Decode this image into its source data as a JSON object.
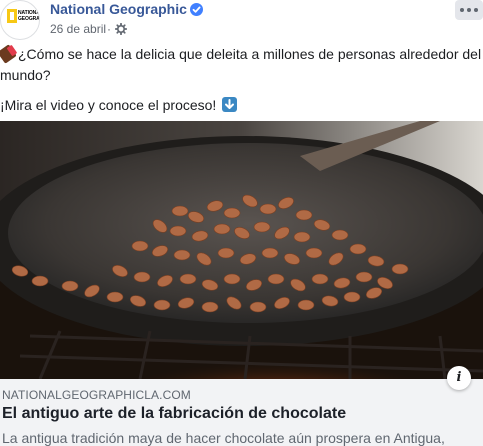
{
  "post": {
    "page_name": "National Geographic",
    "avatar_text": "NATIONAL GEOGRAPHIC",
    "date": "26 de abril",
    "separator": "·",
    "text_line1": "¿Cómo se hace la delicia que deleita a millones de personas alrededor del mundo?",
    "text_line2": "¡Mira el video y conoce el proceso!",
    "icons": [
      "chocolate-emoji",
      "down-arrow-emoji",
      "verified-badge",
      "globe-icon",
      "more-options-icon",
      "info-icon"
    ]
  },
  "link": {
    "domain": "NATIONALGEOGRAPHICLA.COM",
    "title": "El antiguo arte de la fabricación de chocolate",
    "description": "La antigua tradición maya de hacer chocolate aún prospera en Antigua,",
    "info_label": "i"
  },
  "colors": {
    "page_name": "#385898",
    "verified": "#4080ff",
    "link_meta_bg": "#f2f3f5"
  }
}
